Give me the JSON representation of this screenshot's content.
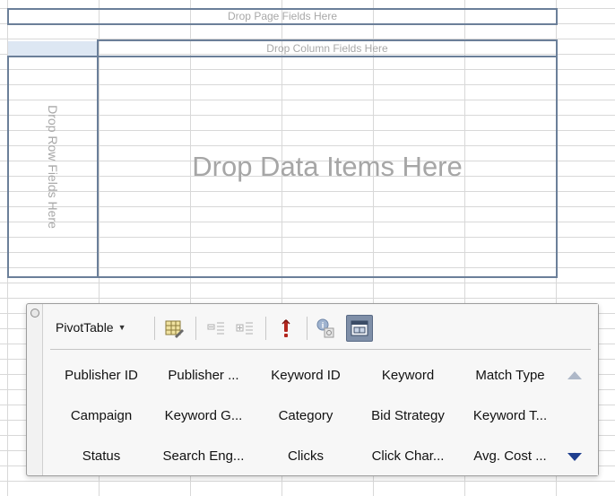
{
  "drop_zones": {
    "page": "Drop Page Fields Here",
    "column": "Drop Column Fields Here",
    "row": "Drop Row Fields Here",
    "data": "Drop Data Items Here"
  },
  "palette": {
    "pivot_button_label": "PivotTable",
    "toolbar_icons": [
      "format-report-icon",
      "hide-detail-icon",
      "show-detail-icon",
      "refresh-data-icon",
      "field-settings-icon",
      "field-list-toggle-icon"
    ],
    "fields": [
      [
        "Publisher ID",
        "Publisher ...",
        "Keyword ID",
        "Keyword",
        "Match Type"
      ],
      [
        "Campaign",
        "Keyword G...",
        "Category",
        "Bid Strategy",
        "Keyword T..."
      ],
      [
        "Status",
        "Search Eng...",
        "Clicks",
        "Click Char...",
        "Avg. Cost ..."
      ]
    ],
    "scroll_up_icon": "scroll-up-icon",
    "scroll_down_icon": "scroll-down-icon"
  },
  "colors": {
    "drop_zone_border": "#6b7f99",
    "active_button": "#7f8fa8"
  }
}
